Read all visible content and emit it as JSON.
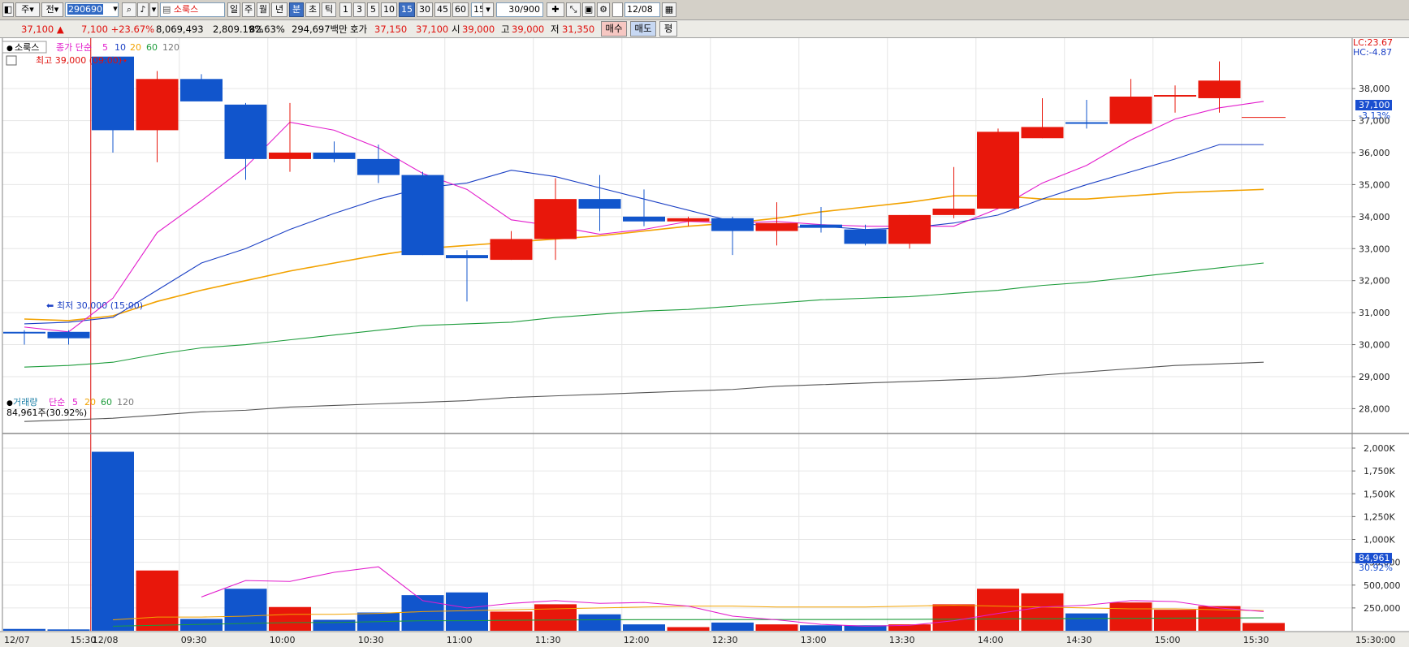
{
  "toolbar": {
    "market": "주",
    "prefix": "전",
    "code": "290690",
    "stock_name": "소룩스",
    "period_buttons": [
      "일",
      "주",
      "월",
      "년",
      "분",
      "초",
      "틱"
    ],
    "active_period": "분",
    "interval_buttons": [
      "1",
      "3",
      "5",
      "10",
      "15",
      "30",
      "45",
      "60"
    ],
    "active_interval": "15",
    "interval_value": "15",
    "count_value": "30/900",
    "date_value": "12/08"
  },
  "info": {
    "price": "37,100",
    "change": "7,100",
    "change_pct": "+23.67%",
    "volume": "8,069,493",
    "volume_ratio": "2,809.19%",
    "turnover": "82.63%",
    "amount": "294,697백만",
    "quote_label": "호가",
    "ask": "37,150",
    "bid": "37,100",
    "open_label": "시",
    "open": "39,000",
    "high_label": "고",
    "high": "39,000",
    "low_label": "저",
    "low": "31,350",
    "buy_button": "매수",
    "sell_button": "매도",
    "eval_button": "평"
  },
  "colors": {
    "up": "#e8170b",
    "down": "#1155cc",
    "ma5": "#e21bcc",
    "ma10": "#1a3fc4",
    "ma20": "#f2a200",
    "ma60": "#1d9c3b",
    "ma120": "#555555"
  },
  "chart_data": {
    "type": "candlestick",
    "price_panel": {
      "title": "소룩스",
      "legend": {
        "label": "종가 단순",
        "periods": [
          "5",
          "10",
          "20",
          "60",
          "120"
        ]
      },
      "high_annotation": "최고 39,000 (09:00)",
      "low_annotation": "최저 30,000 (15:00)",
      "lc_label": "LC:23.67",
      "hc_label": "HC:-4.87",
      "current_price_label": "37,100",
      "current_pct_label": "-3.13%",
      "ylim": [
        27300,
        39500
      ],
      "y_ticks": [
        "28,000",
        "29,000",
        "30,000",
        "31,000",
        "32,000",
        "33,000",
        "34,000",
        "35,000",
        "36,000",
        "37,000",
        "38,000"
      ],
      "candles": [
        {
          "time": "12/07 15:15",
          "open": 30400,
          "high": 30450,
          "low": 30000,
          "close": 30350
        },
        {
          "time": "12/07 15:30",
          "open": 30400,
          "high": 30450,
          "low": 30000,
          "close": 30200
        },
        {
          "time": "12/08 09:00",
          "open": 39000,
          "high": 39000,
          "low": 36000,
          "close": 36700
        },
        {
          "time": "09:15",
          "open": 36700,
          "high": 38550,
          "low": 35700,
          "close": 38300
        },
        {
          "time": "09:30",
          "open": 38300,
          "high": 38450,
          "low": 37600,
          "close": 37600
        },
        {
          "time": "09:45",
          "open": 37500,
          "high": 37550,
          "low": 35150,
          "close": 35800
        },
        {
          "time": "10:00",
          "open": 35800,
          "high": 37550,
          "low": 35400,
          "close": 36000
        },
        {
          "time": "10:15",
          "open": 36000,
          "high": 36350,
          "low": 35700,
          "close": 35800
        },
        {
          "time": "10:30",
          "open": 35800,
          "high": 36250,
          "low": 35050,
          "close": 35300
        },
        {
          "time": "10:45",
          "open": 35300,
          "high": 35400,
          "low": 32800,
          "close": 32800
        },
        {
          "time": "11:00",
          "open": 32800,
          "high": 32950,
          "low": 31350,
          "close": 32700
        },
        {
          "time": "11:15",
          "open": 32650,
          "high": 33550,
          "low": 32650,
          "close": 33300
        },
        {
          "time": "11:30",
          "open": 33300,
          "high": 35200,
          "low": 32650,
          "close": 34550
        },
        {
          "time": "11:45",
          "open": 34550,
          "high": 35300,
          "low": 33550,
          "close": 34250
        },
        {
          "time": "12:00",
          "open": 34000,
          "high": 34850,
          "low": 33700,
          "close": 33850
        },
        {
          "time": "12:15",
          "open": 33850,
          "high": 34000,
          "low": 33700,
          "close": 33950
        },
        {
          "time": "12:30",
          "open": 33950,
          "high": 34000,
          "low": 32800,
          "close": 33550
        },
        {
          "time": "12:45",
          "open": 33550,
          "high": 34450,
          "low": 33100,
          "close": 33800
        },
        {
          "time": "13:00",
          "open": 33750,
          "high": 34300,
          "low": 33500,
          "close": 33650
        },
        {
          "time": "13:15",
          "open": 33600,
          "high": 33750,
          "low": 33100,
          "close": 33150
        },
        {
          "time": "13:30",
          "open": 33150,
          "high": 34050,
          "low": 33000,
          "close": 34050
        },
        {
          "time": "13:45",
          "open": 34050,
          "high": 35550,
          "low": 33950,
          "close": 34250
        },
        {
          "time": "14:00",
          "open": 34250,
          "high": 36750,
          "low": 34250,
          "close": 36650
        },
        {
          "time": "14:15",
          "open": 36450,
          "high": 37700,
          "low": 36450,
          "close": 36800
        },
        {
          "time": "14:30",
          "open": 36950,
          "high": 37650,
          "low": 36750,
          "close": 36900
        },
        {
          "time": "14:45",
          "open": 36900,
          "high": 38300,
          "low": 36900,
          "close": 37750
        },
        {
          "time": "15:00",
          "open": 37750,
          "high": 38100,
          "low": 37250,
          "close": 37800
        },
        {
          "time": "15:15",
          "open": 37700,
          "high": 38850,
          "low": 37250,
          "close": 38250
        },
        {
          "time": "15:30",
          "open": 37100,
          "high": 37100,
          "low": 37100,
          "close": 37100
        }
      ],
      "ma": {
        "ma5": [
          30550,
          30400,
          31450,
          33500,
          34500,
          35550,
          36950,
          36700,
          36150,
          35350,
          34850,
          33900,
          33700,
          33450,
          33600,
          33850,
          33800,
          33850,
          33750,
          33700,
          33700,
          33700,
          34250,
          35050,
          35600,
          36400,
          37050,
          37400,
          37600
        ],
        "ma10": [
          30650,
          30700,
          30850,
          31700,
          32550,
          33000,
          33600,
          34100,
          34550,
          34900,
          35050,
          35450,
          35250,
          34900,
          34550,
          34200,
          33850,
          33650,
          33700,
          33600,
          33650,
          33800,
          34050,
          34550,
          35000,
          35400,
          35800,
          36250,
          36250
        ],
        "ma20": [
          30800,
          30750,
          30900,
          31350,
          31700,
          32000,
          32300,
          32550,
          32800,
          33000,
          33100,
          33200,
          33300,
          33400,
          33550,
          33700,
          33800,
          33950,
          34150,
          34300,
          34450,
          34650,
          34650,
          34550,
          34550,
          34650,
          34750,
          34800,
          34850
        ],
        "ma60": [
          29300,
          29350,
          29450,
          29700,
          29900,
          30000,
          30150,
          30300,
          30450,
          30600,
          30650,
          30700,
          30850,
          30950,
          31050,
          31100,
          31200,
          31300,
          31400,
          31450,
          31500,
          31600,
          31700,
          31850,
          31950,
          32100,
          32250,
          32400,
          32550
        ],
        "ma120": [
          27600,
          27650,
          27700,
          27800,
          27900,
          27950,
          28050,
          28100,
          28150,
          28200,
          28250,
          28350,
          28400,
          28450,
          28500,
          28550,
          28600,
          28700,
          28750,
          28800,
          28850,
          28900,
          28950,
          29050,
          29150,
          29250,
          29350,
          29400,
          29450
        ]
      }
    },
    "volume_panel": {
      "title": "거래량",
      "legend": {
        "label": "단순",
        "periods": [
          "5",
          "20",
          "60",
          "120"
        ]
      },
      "current_label": "84,961주(30.92%)",
      "current_value_label": "84,961",
      "current_pct_label": "30.92%",
      "ylim": [
        0,
        2080000
      ],
      "y_ticks": [
        "250,000",
        "500,000",
        "750,000",
        "1,000K",
        "1,250K",
        "1,500K",
        "1,750K",
        "2,000K"
      ],
      "volumes": [
        20000,
        15000,
        1960000,
        660000,
        130000,
        460000,
        260000,
        120000,
        200000,
        390000,
        420000,
        210000,
        290000,
        180000,
        70000,
        40000,
        90000,
        70000,
        60000,
        60000,
        70000,
        290000,
        460000,
        410000,
        190000,
        310000,
        230000,
        270000,
        85000
      ],
      "ma5": [
        null,
        null,
        null,
        null,
        370000,
        550000,
        540000,
        640000,
        700000,
        330000,
        250000,
        300000,
        330000,
        300000,
        310000,
        270000,
        160000,
        120000,
        70000,
        50000,
        60000,
        110000,
        190000,
        260000,
        280000,
        330000,
        320000,
        250000,
        210000
      ],
      "ma20": [
        null,
        null,
        120000,
        150000,
        150000,
        160000,
        180000,
        180000,
        190000,
        210000,
        220000,
        230000,
        240000,
        250000,
        260000,
        270000,
        270000,
        260000,
        260000,
        260000,
        270000,
        280000,
        270000,
        260000,
        250000,
        240000,
        240000,
        230000,
        220000
      ],
      "ma60": [
        null,
        null,
        50000,
        60000,
        70000,
        80000,
        90000,
        90000,
        100000,
        110000,
        110000,
        115000,
        118000,
        120000,
        122000,
        122000,
        123000,
        123000,
        123000,
        124000,
        125000,
        127000,
        130000,
        132000,
        134000,
        136000,
        138000,
        140000,
        142000
      ]
    },
    "x_ticks": [
      {
        "i": 0,
        "label": "12/07"
      },
      {
        "i": 1.5,
        "label": "15:30"
      },
      {
        "i": 2,
        "label": "12/08"
      },
      {
        "i": 4,
        "label": "09:30"
      },
      {
        "i": 6,
        "label": "10:00"
      },
      {
        "i": 8,
        "label": "10:30"
      },
      {
        "i": 10,
        "label": "11:00"
      },
      {
        "i": 12,
        "label": "11:30"
      },
      {
        "i": 14,
        "label": "12:00"
      },
      {
        "i": 16,
        "label": "12:30"
      },
      {
        "i": 18,
        "label": "13:00"
      },
      {
        "i": 20,
        "label": "13:30"
      },
      {
        "i": 22,
        "label": "14:00"
      },
      {
        "i": 24,
        "label": "14:30"
      },
      {
        "i": 26,
        "label": "15:00"
      },
      {
        "i": 28,
        "label": "15:30"
      },
      {
        "i": 30,
        "label": "15:30:00"
      }
    ]
  }
}
